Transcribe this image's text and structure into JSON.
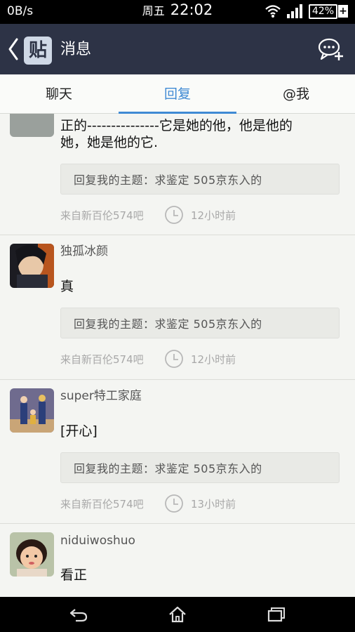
{
  "status": {
    "speed": "0B/s",
    "day": "周五",
    "time": "22:02",
    "battery": "42%",
    "battery_plus": "+"
  },
  "header": {
    "logo_char": "贴",
    "title": "消息"
  },
  "tabs": [
    {
      "label": "聊天"
    },
    {
      "label": "回复"
    },
    {
      "label": "@我"
    }
  ],
  "items": [
    {
      "author": "",
      "line1": "正的---------------它是她的他，他是他的",
      "line2": "她，她是他的它.",
      "quote": "回复我的主题：求鉴定 505京东入的",
      "source": "来自新百伦574吧",
      "time": "12小时前"
    },
    {
      "author": "独孤冰颜",
      "line1": "真",
      "line2": "",
      "quote": "回复我的主题：求鉴定 505京东入的",
      "source": "来自新百伦574吧",
      "time": "12小时前"
    },
    {
      "author": "super特工家庭",
      "line1": "[开心]",
      "line2": "",
      "quote": "回复我的主题：求鉴定 505京东入的",
      "source": "来自新百伦574吧",
      "time": "13小时前"
    },
    {
      "author": "niduiwoshuo",
      "line1": "看正",
      "line2": "",
      "quote": "",
      "source": "",
      "time": ""
    }
  ],
  "icons": {
    "back": "chevron-left-icon",
    "compose": "chat-plus-icon",
    "clock": "clock-icon",
    "nav_back": "back-arrow-icon",
    "nav_home": "home-icon",
    "nav_recent": "recent-apps-icon"
  },
  "colors": {
    "accent": "#3f8ad4",
    "header_bg": "#2d3346"
  }
}
